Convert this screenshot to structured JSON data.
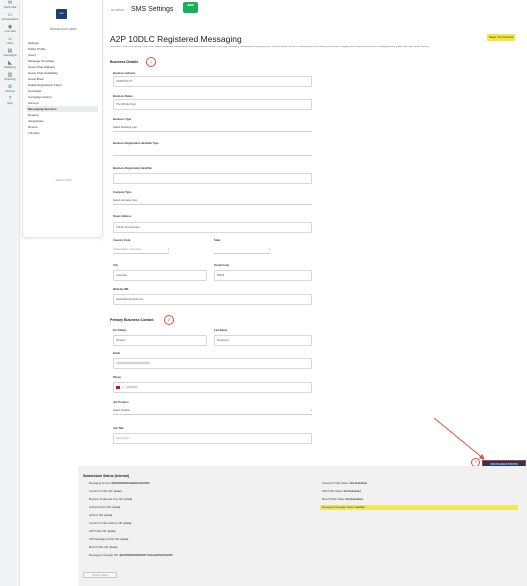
{
  "rail": {
    "items": [
      {
        "label": "Quick Chat",
        "icon": "chat-icon"
      },
      {
        "label": "Conversations",
        "icon": "inbox-icon"
      },
      {
        "label": "Live Chat",
        "icon": "live-chat-icon"
      },
      {
        "label": "Users",
        "icon": "users-icon"
      },
      {
        "label": "Campaigns",
        "icon": "campaign-icon"
      },
      {
        "label": "Marketing",
        "icon": "megaphone-icon"
      },
      {
        "label": "Reporting",
        "icon": "bar-chart-icon"
      },
      {
        "label": "Settings",
        "icon": "gear-icon",
        "color": "#1e9e56"
      },
      {
        "label": "Help",
        "icon": "help-icon"
      }
    ]
  },
  "sidebar": {
    "logo_text": "SMS",
    "account_name": "BOOZE COCO HAWS",
    "items": [
      {
        "label": "Settings",
        "active": false
      },
      {
        "label": "Public Profile",
        "active": false
      },
      {
        "label": "Users",
        "active": false
      },
      {
        "label": "Message Templates",
        "active": false
      },
      {
        "label": "Guest Chat Widgets",
        "active": false
      },
      {
        "label": "Guest Chat Availability",
        "active": false
      },
      {
        "label": "Guest Book",
        "active": false
      },
      {
        "label": "Digital Registration Flows",
        "active": false
      },
      {
        "label": "Templates",
        "active": false
      },
      {
        "label": "Campaign History",
        "active": false
      },
      {
        "label": "Surveys",
        "active": false
      },
      {
        "label": "Messaging Services",
        "active": true
      },
      {
        "label": "Reports",
        "active": false
      },
      {
        "label": "Integrations",
        "active": false
      },
      {
        "label": "Rooms",
        "active": false
      },
      {
        "label": "Tutorials",
        "active": false
      }
    ],
    "version": "Version 2.8.19"
  },
  "header": {
    "back_label": "← GO BACK",
    "title": "SMS Settings",
    "badge_glyph": "•••",
    "badge_color": "#17b15c"
  },
  "form": {
    "title": "A2P 10DLC Registered Messaging",
    "status_tag": "Status: Not Submitted",
    "intro": "A2P 10DLC refers to a system in the United States that allows businesses to send Application-to-Person (A2P) type messaging via standard 10-digit long code (10DLC) phone numbers. Please provide the following information to register your business and ensure message delivery quality and lower carrier filtering.",
    "business_section": {
      "heading": "Business Details",
      "step": "1",
      "fields": {
        "industry": {
          "label": "Business Industry",
          "value": "HOSPITALITY"
        },
        "name": {
          "label": "Business Name",
          "value": "The Whistle Stop"
        },
        "type": {
          "label": "Business Type",
          "value": "Select business type"
        },
        "identifier_type": {
          "label": "Business Registration Identifier Type",
          "value": ""
        },
        "identifier": {
          "label": "Business Registration Identifier",
          "value": ""
        },
        "company_type": {
          "label": "Company Type",
          "value": "Select company type"
        },
        "street": {
          "label": "Street Address",
          "value": "10419 Columbia Ave"
        },
        "country": {
          "label": "Country Code",
          "value": "United States of America"
        },
        "state": {
          "label": "State",
          "value": ""
        },
        "city": {
          "label": "City",
          "value": "Columbia"
        },
        "postal": {
          "label": "Postal Code",
          "value": "58016"
        },
        "website": {
          "label": "Website URL",
          "value": "thewhistlestopdiner.com"
        }
      }
    },
    "contact_section": {
      "heading": "Primary Business Contact",
      "step": "2",
      "fields": {
        "first_name": {
          "label": "First Name",
          "value": "Winston"
        },
        "last_name": {
          "label": "Last Name",
          "value": "Dougherty"
        },
        "email": {
          "label": "Email",
          "value": ""
        },
        "phone": {
          "label": "Phone",
          "value": ""
        },
        "job_position": {
          "label": "Job Position",
          "value": "Select position"
        },
        "job_title": {
          "label": "Job Title",
          "value": "Director Ext"
        }
      }
    },
    "update_button": "UPDATE REGISTRATION",
    "update_step": "3"
  },
  "submission": {
    "title": "Submission Status (Internal)",
    "left_items": [
      {
        "label": "Messaging Service:",
        "value": "MG0000000003e99ab0e0b07f02c"
      },
      {
        "label": "Customer Profile SID:",
        "value": "(none)"
      },
      {
        "label": "Business Profile End-User SID:",
        "value": "(none)"
      },
      {
        "label": "Authorized Rep SID:",
        "value": "(none)"
      },
      {
        "label": "Address SID:",
        "value": "(none)"
      },
      {
        "label": "Customer Profile Address SID:",
        "value": "(none)"
      },
      {
        "label": "A2P Profile SID:",
        "value": "(none)"
      },
      {
        "label": "A2P Messaging Profile SID:",
        "value": "(none)"
      },
      {
        "label": "Brand Profile SID:",
        "value": "(none)"
      },
      {
        "label": "Messaging Campaign SID:",
        "value": "QE2000000000000000??A0e0a497d5e55a500"
      }
    ],
    "right_items": [
      {
        "label": "Customer Profile Status:",
        "value": "Not Submitted",
        "highlight": false
      },
      {
        "label": "A2P Profile Status:",
        "value": "Not Submitted",
        "highlight": false
      },
      {
        "label": "Brand Profile Status:",
        "value": "Not Submitted",
        "highlight": false
      },
      {
        "label": "Messaging Campaign Status:",
        "value": "Inactive",
        "highlight": true
      }
    ],
    "refresh_button": "Refresh Status"
  },
  "colors": {
    "accent_green": "#17b15c",
    "annotation_red": "#e24b3b",
    "update_button_bg": "#1f3a63",
    "status_yellow": "#f5e53c"
  }
}
